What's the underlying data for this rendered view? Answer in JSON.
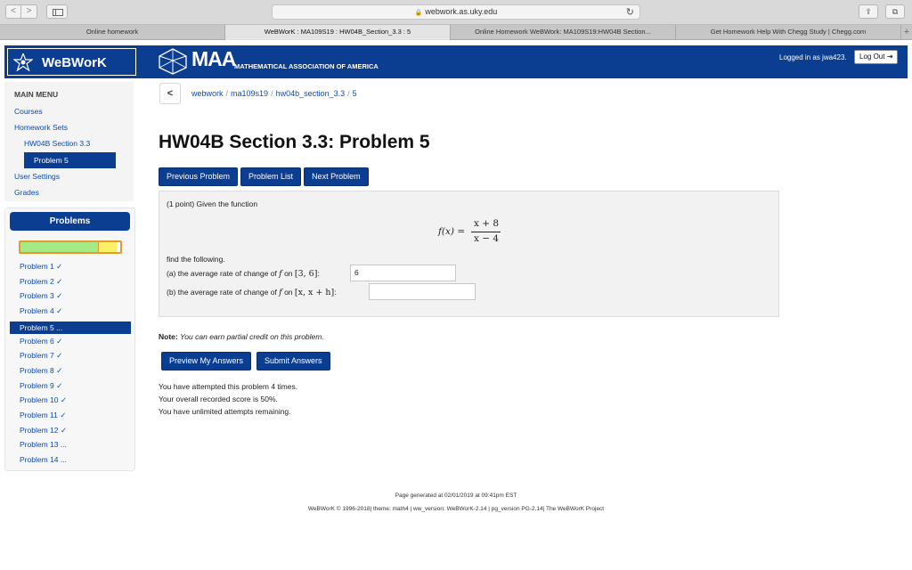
{
  "browser": {
    "back": "<",
    "forward": ">",
    "url": "webwork.as.uky.edu",
    "tabs": [
      {
        "label": "Online homework"
      },
      {
        "label": "WeBWorK : MA109S19 : HW04B_Section_3.3 : 5"
      },
      {
        "label": "Online Homework WeBWork: MA109S19:HW04B Section..."
      },
      {
        "label": "Get Homework Help With Chegg Study | Chegg.com"
      }
    ],
    "new_tab": "+"
  },
  "header": {
    "logo_text": "WeBWorK",
    "maa_big": "MAA",
    "maa_small": "MATHEMATICAL ASSOCIATION OF AMERICA",
    "login_text": "Logged in as jwa423.",
    "logout_label": "Log Out"
  },
  "main_menu": {
    "title": "MAIN MENU",
    "courses": "Courses",
    "homework_sets": "Homework Sets",
    "set_name": "HW04B Section 3.3",
    "current_problem": "Problem 5",
    "user_settings": "User Settings",
    "grades": "Grades"
  },
  "problems": {
    "title": "Problems",
    "progress_correct_fraction": 0.78,
    "progress_partial_fraction": 0.18,
    "items": [
      "Problem 1 ✓",
      "Problem 2 ✓",
      "Problem 3 ✓",
      "Problem 4 ✓",
      "Problem 5 ...",
      "Problem 6 ✓",
      "Problem 7 ✓",
      "Problem 8 ✓",
      "Problem 9 ✓",
      "Problem 10 ✓",
      "Problem 11 ✓",
      "Problem 12 ✓",
      "Problem 13 ...",
      "Problem 14 ..."
    ],
    "active_index": 4
  },
  "breadcrumb": {
    "back": "<",
    "parts": [
      "webwork",
      "ma109s19",
      "hw04b_section_3.3",
      "5"
    ],
    "separator": "/"
  },
  "page": {
    "title": "HW04B Section 3.3: Problem 5",
    "prev_label": "Previous Problem",
    "list_label": "Problem List",
    "next_label": "Next Problem"
  },
  "problem": {
    "intro": "(1 point) Given the function",
    "formula_lhs": "f(x) =",
    "formula_num": "x + 8",
    "formula_den": "x − 4",
    "find": "find the following.",
    "qa_text": "(a) the average rate of change of ",
    "qa_math": "f",
    "qa_on": " on ",
    "qa_interval": "[3, 6]",
    "qa_colon": ":",
    "qa_value": "6",
    "qb_text": "(b) the average rate of change of ",
    "qb_math": "f",
    "qb_on": " on ",
    "qb_interval": "[x, x + h]",
    "qb_colon": ":",
    "qb_value": ""
  },
  "note": {
    "label": "Note:",
    "text": "You can earn partial credit on this problem."
  },
  "actions": {
    "preview_label": "Preview My Answers",
    "submit_label": "Submit Answers"
  },
  "status": {
    "attempts": "You have attempted this problem 4 times.",
    "score": "Your overall recorded score is 50%.",
    "remaining": "You have unlimited attempts remaining."
  },
  "footer": {
    "generated": "Page generated at 02/01/2019 at 09:41pm EST",
    "copyright": "WeBWorK © 1996-2018| theme: math4 | ww_version: WeBWorK-2.14 | pg_version PG-2.14| The WeBWorK Project"
  },
  "colors": {
    "navy": "#0b3d91",
    "link": "#0a4bb3",
    "progress_green": "#a6ea85",
    "progress_yellow": "#fbf066",
    "progress_border": "#e39b2f"
  }
}
